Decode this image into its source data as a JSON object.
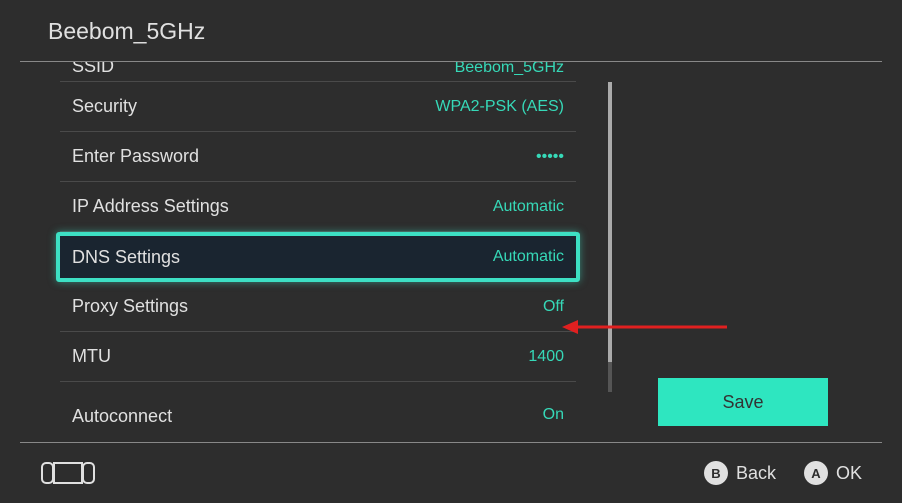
{
  "header": {
    "title": "Beebom_5GHz"
  },
  "settings": {
    "ssid_label": "SSID",
    "ssid_value": "Beebom_5GHz",
    "security_label": "Security",
    "security_value": "WPA2-PSK (AES)",
    "password_label": "Enter Password",
    "password_value": "•••••",
    "ip_label": "IP Address Settings",
    "ip_value": "Automatic",
    "dns_label": "DNS Settings",
    "dns_value": "Automatic",
    "proxy_label": "Proxy Settings",
    "proxy_value": "Off",
    "mtu_label": "MTU",
    "mtu_value": "1400",
    "autoconnect_label": "Autoconnect",
    "autoconnect_value": "On"
  },
  "buttons": {
    "save": "Save"
  },
  "footer": {
    "back_letter": "B",
    "back_label": "Back",
    "ok_letter": "A",
    "ok_label": "OK"
  }
}
